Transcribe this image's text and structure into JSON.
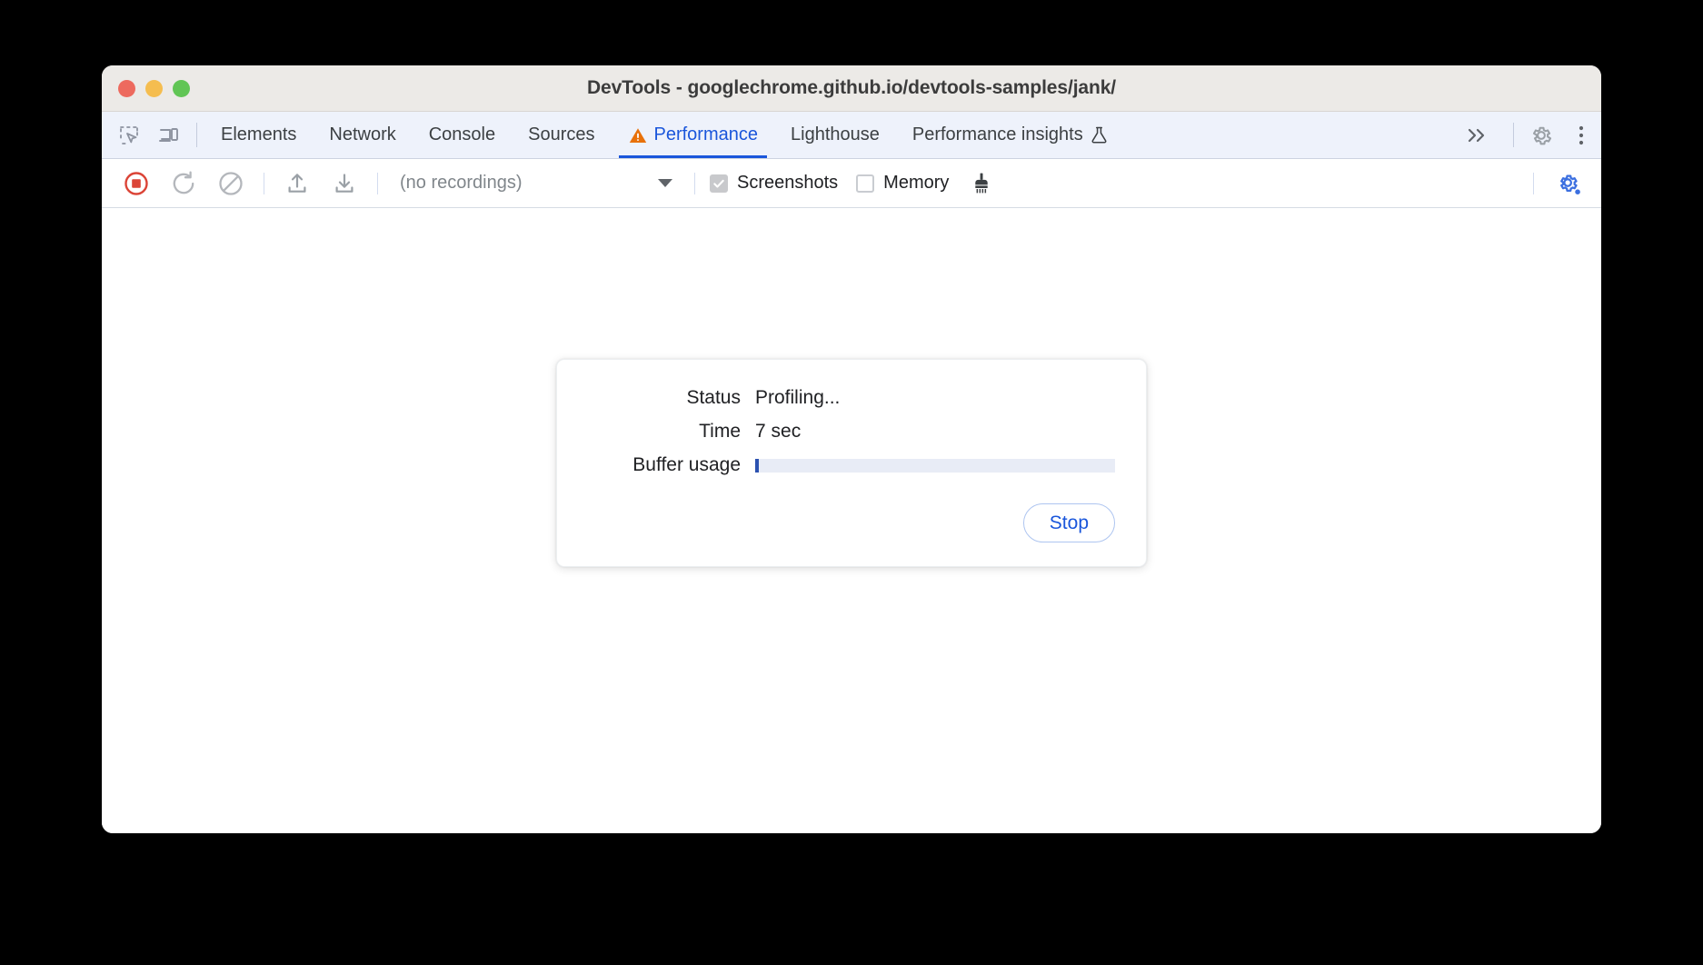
{
  "window": {
    "title": "DevTools - googlechrome.github.io/devtools-samples/jank/",
    "traffic_lights": [
      {
        "name": "close",
        "color": "#ed6a5e"
      },
      {
        "name": "minimize",
        "color": "#f5bd4f"
      },
      {
        "name": "zoom",
        "color": "#61c555"
      }
    ]
  },
  "tabbar": {
    "left_icons": [
      {
        "name": "inspect-element-icon",
        "title": "Inspect element"
      },
      {
        "name": "device-toolbar-icon",
        "title": "Toggle device toolbar"
      }
    ],
    "tabs": [
      {
        "label": "Elements",
        "active": false,
        "warning": false,
        "experiment": false
      },
      {
        "label": "Network",
        "active": false,
        "warning": false,
        "experiment": false
      },
      {
        "label": "Console",
        "active": false,
        "warning": false,
        "experiment": false
      },
      {
        "label": "Sources",
        "active": false,
        "warning": false,
        "experiment": false
      },
      {
        "label": "Performance",
        "active": true,
        "warning": true,
        "experiment": false
      },
      {
        "label": "Lighthouse",
        "active": false,
        "warning": false,
        "experiment": false
      },
      {
        "label": "Performance insights",
        "active": false,
        "warning": false,
        "experiment": true
      }
    ],
    "more_tabs_label": "»",
    "settings_label": "Settings",
    "menu_label": "Customize and control DevTools",
    "active_color": "#1a56db",
    "warning_color": "#e8710a"
  },
  "toolbar": {
    "record_title": "Stop recording",
    "reload_title": "Record and reload",
    "clear_title": "Clear",
    "load_title": "Load profile",
    "save_title": "Save profile",
    "recordings_value": "(no recordings)",
    "screenshots": {
      "label": "Screenshots",
      "checked": true,
      "disabled": true
    },
    "memory": {
      "label": "Memory",
      "checked": false,
      "disabled": false
    },
    "gc_title": "Collect garbage",
    "capture_settings_title": "Capture settings",
    "record_color": "#db4437",
    "capture_settings_color": "#3b6fe0"
  },
  "status_dialog": {
    "rows": [
      {
        "label": "Status",
        "value": "Profiling..."
      },
      {
        "label": "Time",
        "value": "7 sec"
      }
    ],
    "buffer_label": "Buffer usage",
    "buffer_percent": 1,
    "stop_label": "Stop",
    "track_color": "#e8ecf6",
    "fill_color": "#2c52b0",
    "stop_text_color": "#1a56db"
  }
}
